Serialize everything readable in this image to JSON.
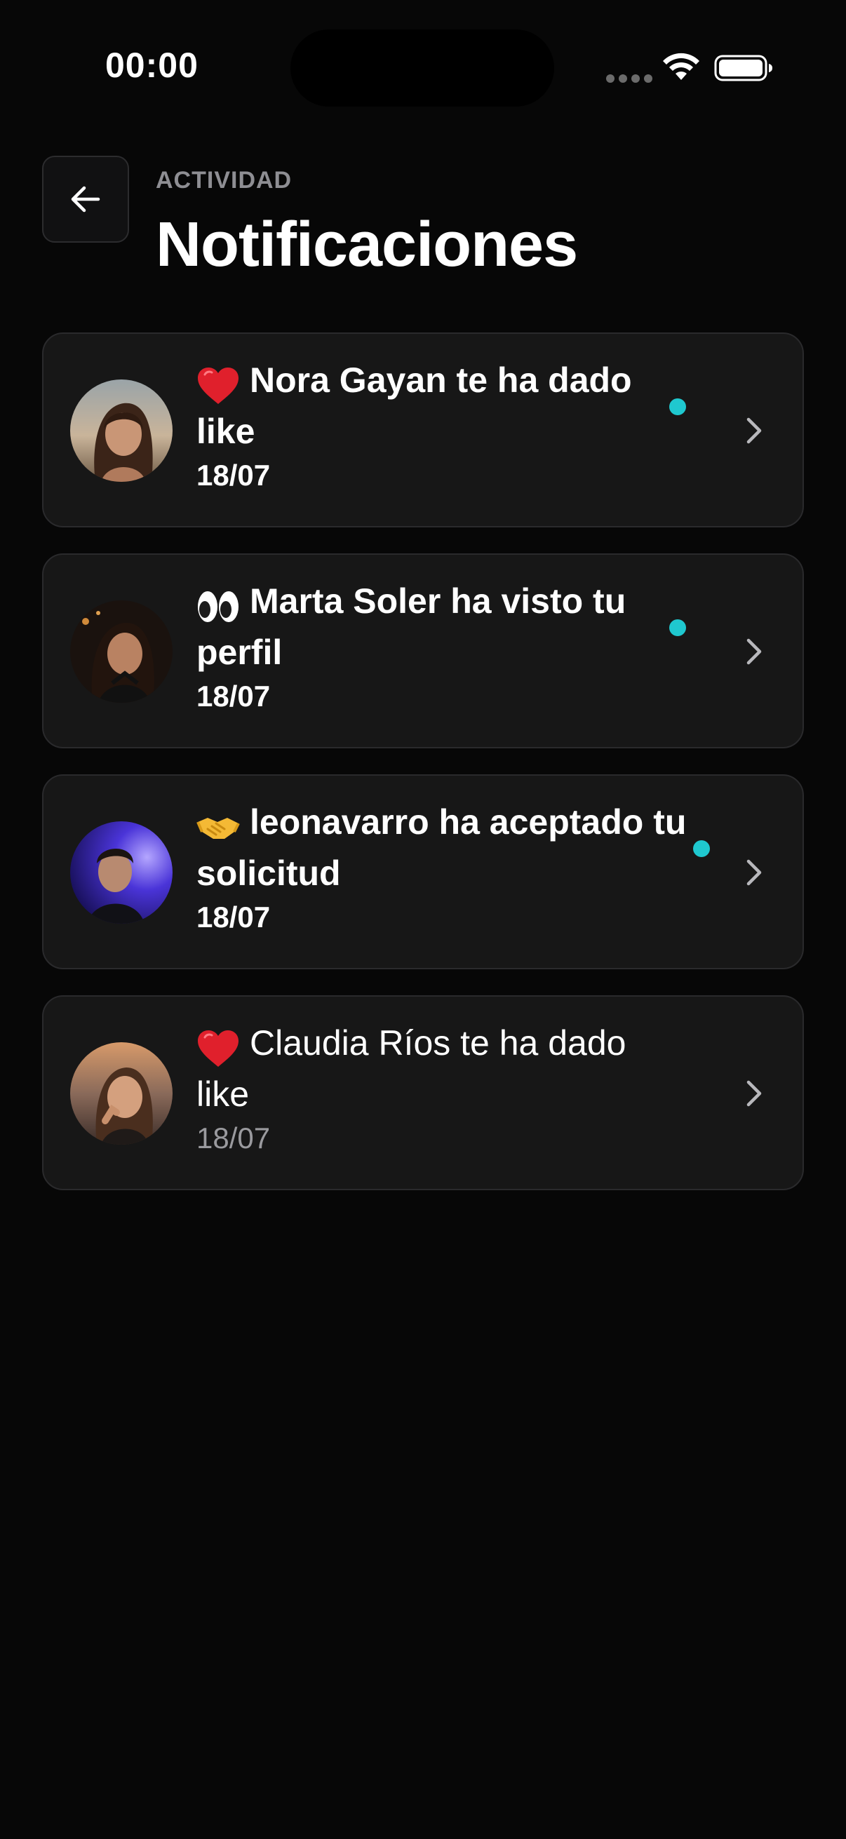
{
  "status_bar": {
    "time": "00:00"
  },
  "header": {
    "overline": "ACTIVIDAD",
    "title": "Notificaciones"
  },
  "notifications": [
    {
      "emoji": "heart-icon",
      "message": "Nora Gayan te ha dado like",
      "date": "18/07",
      "unread": true
    },
    {
      "emoji": "eyes-icon",
      "message": "Marta Soler ha visto tu perfil",
      "date": "18/07",
      "unread": true
    },
    {
      "emoji": "handshake-icon",
      "message": "leonavarro ha aceptado tu solicitud",
      "date": "18/07",
      "unread": true
    },
    {
      "emoji": "heart-icon",
      "message": "Claudia Ríos te ha dado like",
      "date": "18/07",
      "unread": false
    }
  ],
  "colors": {
    "background": "#070707",
    "card": "#171717",
    "card_border": "#2a2a2c",
    "unread_dot": "#1fc8cf",
    "muted_text": "#8e8e93"
  }
}
